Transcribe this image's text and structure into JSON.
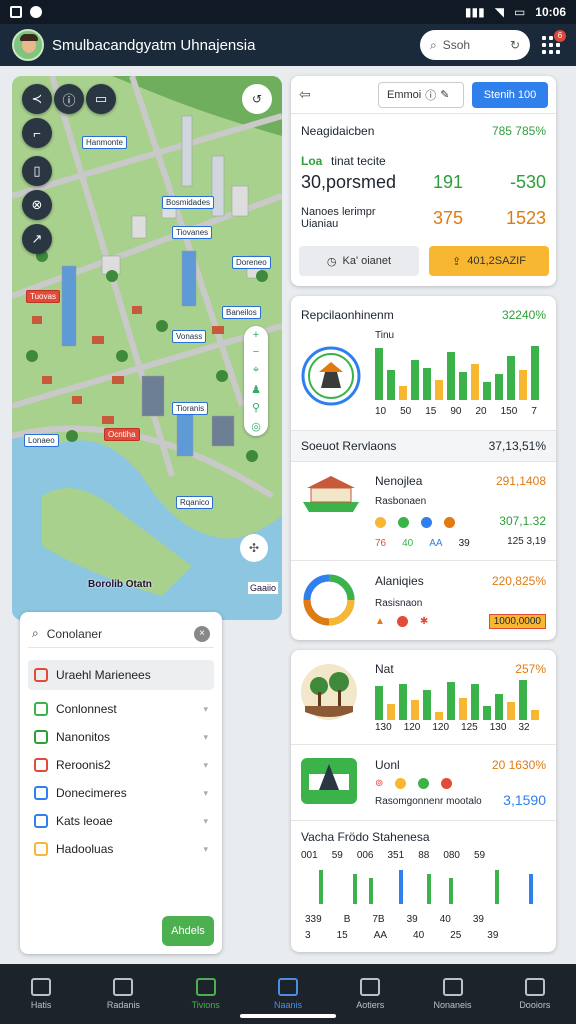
{
  "status_bar": {
    "time": "10:06",
    "left_icons": [
      "sim-icon",
      "settings-icon"
    ]
  },
  "app": {
    "title": "Smulbacandgyatm Uhnajensia",
    "search_placeholder": "Ssoh",
    "notification_count": "6"
  },
  "map": {
    "tool_buttons": [
      "≺",
      "ⓘ",
      "▭",
      "⌐",
      "▯",
      "⊗",
      "↗"
    ],
    "labels": [
      "Hanmonte",
      "Bosmidades",
      "Tiovanes",
      "Tuovas",
      "Baneilos",
      "Vonass",
      "Tioranis",
      "Lonaeo",
      "Ocntiha",
      "Rqanico",
      "Doreneo"
    ],
    "bay_label": "Borolib Otatn",
    "corner_label": "Gaaiio"
  },
  "layers": {
    "search_value": "Conolaner",
    "items": [
      {
        "label": "Uraehl Marienees",
        "color": "#e24b3a",
        "selected": true
      },
      {
        "label": "Conlonnest",
        "color": "#3bb34a"
      },
      {
        "label": "Nanonitos",
        "color": "#2e9e3a"
      },
      {
        "label": "Reroonis2",
        "color": "#e24b3a"
      },
      {
        "label": "Donecimeres",
        "color": "#2f80ed"
      },
      {
        "label": "Kats leoae",
        "color": "#2f80ed"
      },
      {
        "label": "Hadooluas",
        "color": "#f7b731"
      }
    ],
    "apply_label": "Ahdels"
  },
  "card1": {
    "filter_select": "Emmoi",
    "action_button": "Stenih 100",
    "title": "Neagidaicben",
    "title_value": "785 785%",
    "row1_label_a": "Loa",
    "row1_label_b": "tinat tecite",
    "row1_main": "30,porsmed",
    "row1_val1": "191",
    "row1_val2": "-530",
    "row2_label": "Nanoes lerimpr Uianiau",
    "row2_val1": "375",
    "row2_val2": "1523",
    "btn_left": "Ka' oianet",
    "btn_right": "401,2SAZIF"
  },
  "card2": {
    "title": "Repcilaonhinenm",
    "title_value": "32240%",
    "sub": "Tinu",
    "axis_labels": [
      "10",
      "50",
      "15",
      "90",
      "20",
      "150",
      "7"
    ],
    "section_label": "Soeuot Rervlaons",
    "section_value": "37,13,51%",
    "item1": {
      "name": "Nenojlea",
      "value": "291,1408",
      "sub": "Rasbonaen",
      "nums": [
        "307,1.32",
        "125 3,19"
      ],
      "marks": [
        "76",
        "40",
        "AA",
        "39"
      ]
    },
    "item2": {
      "name": "Alaniqies",
      "value": "220,825%",
      "sub": "Rasisnaon",
      "tag": "1000,0000"
    }
  },
  "card3": {
    "item1": {
      "name": "Nat",
      "value": "257%",
      "axis": [
        "130",
        "120",
        "120",
        "125",
        "130",
        "32"
      ]
    },
    "item2": {
      "name": "Uonl",
      "value": "20 1630%",
      "sub": "Rasomgonnenr mootalo",
      "amount": "3,1590"
    },
    "section": "Vacha Frödo  Stahenesa",
    "col_tops": [
      "001",
      "59",
      "006",
      "351",
      "88",
      "080",
      "59"
    ],
    "col_bottoms": [
      "339",
      "B",
      "7B",
      "39",
      "40",
      "39"
    ],
    "col_bottoms2": [
      "3",
      "15",
      "AA",
      "40",
      "25",
      "39"
    ]
  },
  "chart_colors": {
    "green": "#3bb34a",
    "orange": "#f7b731",
    "blue": "#2f80ed"
  },
  "nav": [
    {
      "label": "Hatis",
      "state": "normal"
    },
    {
      "label": "Radanis",
      "state": "normal"
    },
    {
      "label": "Tivions",
      "state": "green"
    },
    {
      "label": "Naanis",
      "state": "blue"
    },
    {
      "label": "Aotiers",
      "state": "normal"
    },
    {
      "label": "Nonaneis",
      "state": "normal"
    },
    {
      "label": "Dooiors",
      "state": "normal"
    }
  ]
}
